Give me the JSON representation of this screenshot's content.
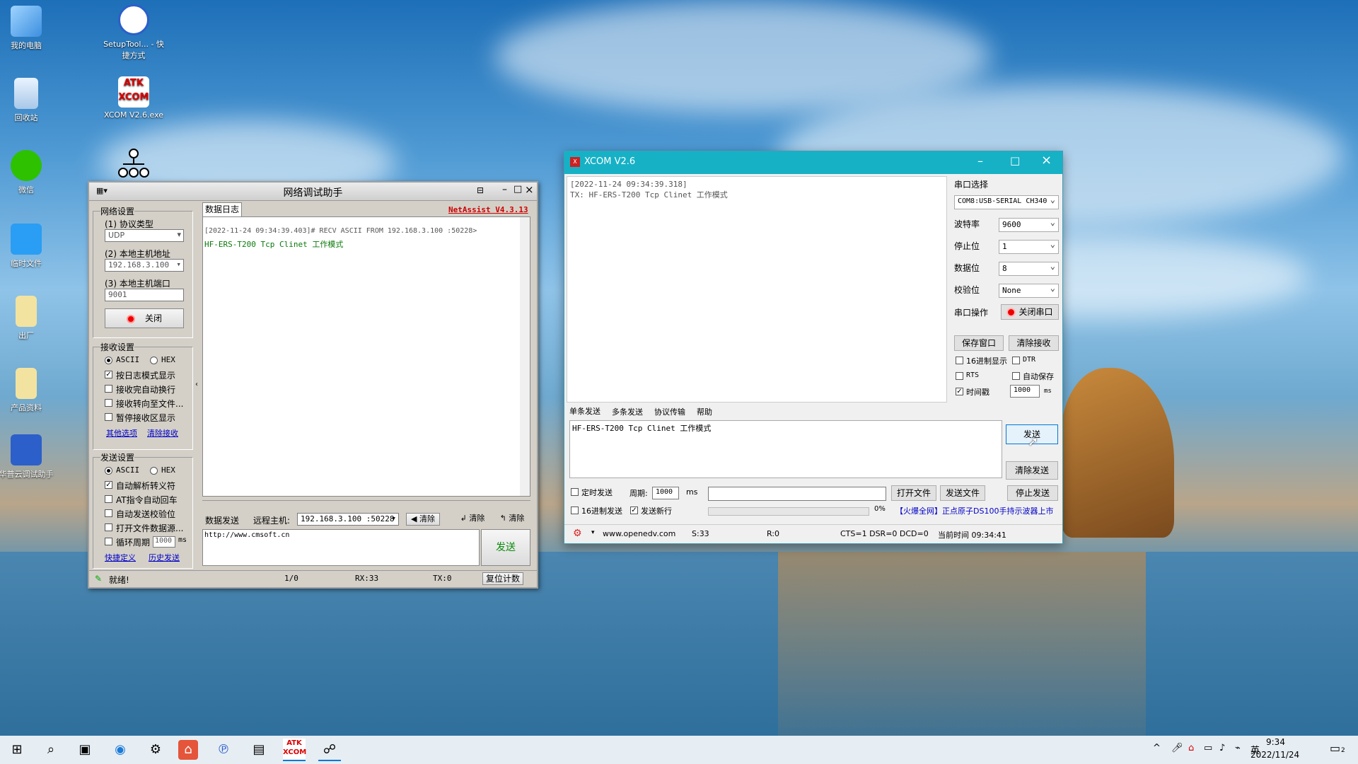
{
  "desktop": {
    "icons": [
      {
        "label": "我的电脑",
        "icon": "computer-icon"
      },
      {
        "label": "回收站",
        "icon": "recycle-bin-icon"
      },
      {
        "label": "微信",
        "icon": "wechat-icon"
      },
      {
        "label": "临时文件",
        "icon": "folder-icon"
      },
      {
        "label": "出厂",
        "icon": "folder-icon"
      },
      {
        "label": "产品资料",
        "icon": "folder-icon"
      },
      {
        "label": "华普云调试助手",
        "icon": "hpiot-icon"
      },
      {
        "label": "SetupTool... - 快捷方式",
        "icon": "hpiot-icon"
      },
      {
        "label": "XCOM V2.6.exe",
        "icon": "xcom-icon"
      }
    ]
  },
  "netassist": {
    "title": "网络调试助手",
    "brand": "NetAssist V4.3.13",
    "net_group": "网络设置",
    "protocol_label": "(1) 协议类型",
    "protocol_value": "UDP",
    "host_label": "(2) 本地主机地址",
    "host_value": "192.168.3.100",
    "port_label": "(3) 本地主机端口",
    "port_value": "9001",
    "close_btn": "关闭",
    "recv_group": "接收设置",
    "ascii": "ASCII",
    "hex": "HEX",
    "recv_opts": [
      "按日志模式显示",
      "接收完自动换行",
      "接收转向至文件...",
      "暂停接收区显示"
    ],
    "recv_links": [
      "其他选项",
      "清除接收"
    ],
    "send_group": "发送设置",
    "send_opts": [
      "自动解析转义符",
      "AT指令自动回车",
      "自动发送校验位",
      "打开文件数据源..."
    ],
    "cycle_label": "循环周期",
    "cycle_value": "1000",
    "cycle_unit": "ms",
    "send_links": [
      "快捷定义",
      "历史发送"
    ],
    "log_tab": "数据日志",
    "log_line1": "[2022-11-24 09:34:39.403]# RECV ASCII FROM 192.168.3.100 :50228>",
    "log_line2": "HF-ERS-T200 Tcp Clinet 工作模式",
    "send_tab": "数据发送",
    "remote_label": "远程主机:",
    "remote_value": "192.168.3.100 :50228",
    "clear1": "清除",
    "clear2": "清除",
    "clear3": "清除",
    "send_input": "http://www.cmsoft.cn",
    "send_btn": "发送",
    "status_ready": "就绪!",
    "status_count": "1/0",
    "status_rx": "RX:33",
    "status_tx": "TX:0",
    "reset_count": "复位计数"
  },
  "xcom": {
    "title": "XCOM V2.6",
    "recv_line1": "[2022-11-24 09:34:39.318]",
    "recv_line2": "TX: HF-ERS-T200 Tcp Clinet 工作模式",
    "port_select_label": "串口选择",
    "port_value": "COM8:USB-SERIAL CH340",
    "baud_label": "波特率",
    "baud_value": "9600",
    "stop_label": "停止位",
    "stop_value": "1",
    "data_label": "数据位",
    "data_value": "8",
    "parity_label": "校验位",
    "parity_value": "None",
    "op_label": "串口操作",
    "close_port": "关闭串口",
    "save_window": "保存窗口",
    "clear_recv": "清除接收",
    "hex_display": "16进制显示",
    "dtr": "DTR",
    "rts": "RTS",
    "auto_save": "自动保存",
    "timestamp": "时间戳",
    "timestamp_value": "1000",
    "ms": "ms",
    "tabs": [
      "单条发送",
      "多条发送",
      "协议传输",
      "帮助"
    ],
    "send_text": "HF-ERS-T200 Tcp Clinet 工作模式",
    "send_btn": "发送",
    "clear_send": "清除发送",
    "timed_send": "定时发送",
    "period_label": "周期:",
    "period_value": "1000",
    "period_unit": "ms",
    "open_file": "打开文件",
    "send_file": "发送文件",
    "stop_send": "停止发送",
    "hex_send": "16进制发送",
    "send_newline": "发送新行",
    "progress": "0%",
    "ad": "【火爆全网】正点原子DS100手持示波器上市",
    "status_url": "www.openedv.com",
    "status_s": "S:33",
    "status_r": "R:0",
    "status_lines": "CTS=1 DSR=0 DCD=0",
    "status_time": "当前时间 09:34:41"
  },
  "taskbar": {
    "time": "9:34",
    "date": "2022/11/24",
    "ime": "英",
    "notif_count": "2"
  }
}
